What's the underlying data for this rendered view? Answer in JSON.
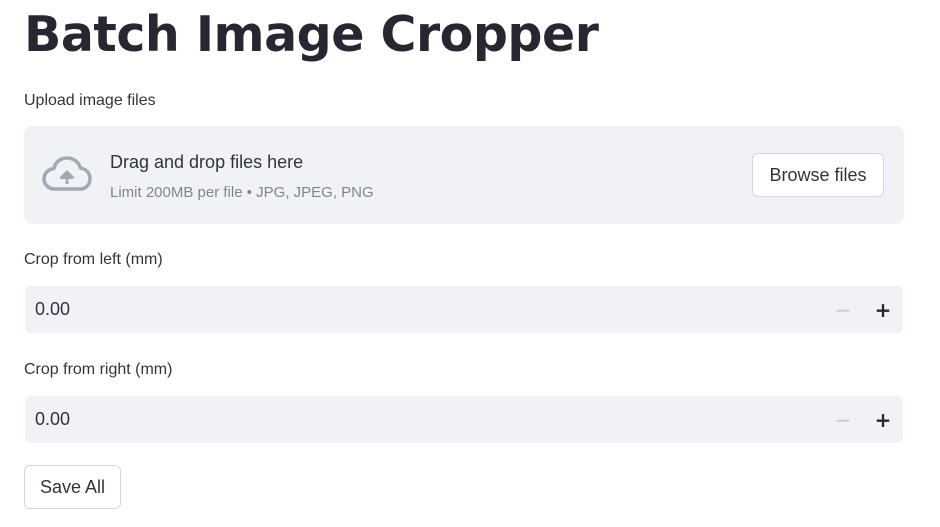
{
  "page": {
    "title": "Batch Image Cropper"
  },
  "uploader": {
    "label": "Upload image files",
    "icon": "cloud-upload-icon",
    "dropzone_title": "Drag and drop files here",
    "dropzone_hint": "Limit 200MB per file • JPG, JPEG, PNG",
    "browse_label": "Browse files"
  },
  "crop_left": {
    "label": "Crop from left (mm)",
    "value": "0.00",
    "minus": "−",
    "plus": "+"
  },
  "crop_right": {
    "label": "Crop from right (mm)",
    "value": "0.00",
    "minus": "−",
    "plus": "+"
  },
  "actions": {
    "save_label": "Save All"
  },
  "colors": {
    "text": "#31333f",
    "title": "#262730",
    "panel_bg": "#f0f2f6",
    "hint": "#808495",
    "icon": "#a3a8b4",
    "disabled": "#c5c8d0"
  }
}
